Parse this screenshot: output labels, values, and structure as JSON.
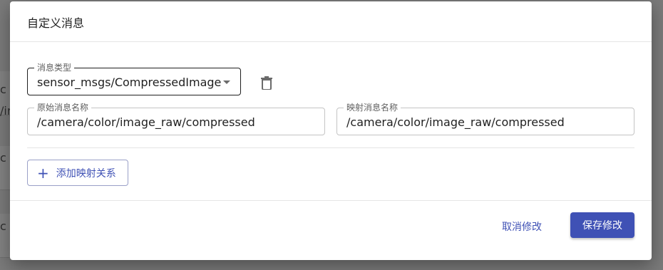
{
  "background": {
    "fragments": [
      "c",
      "/ir",
      "c",
      "c"
    ]
  },
  "dialog": {
    "title": "自定义消息",
    "message_type": {
      "label": "消息类型",
      "value": "sensor_msgs/CompressedImage"
    },
    "original_name": {
      "label": "原始消息名称",
      "value": "/camera/color/image_raw/compressed"
    },
    "mapped_name": {
      "label": "映射消息名称",
      "value": "/camera/color/image_raw/compressed"
    },
    "add_mapping_label": "添加映射关系",
    "cancel_label": "取消修改",
    "save_label": "保存修改"
  },
  "icons": {
    "delete": "trash-icon",
    "dropdown": "caret-down-icon",
    "add": "plus-icon"
  },
  "colors": {
    "primary": "#3f51b5",
    "backdrop": "#7a7a7a"
  }
}
